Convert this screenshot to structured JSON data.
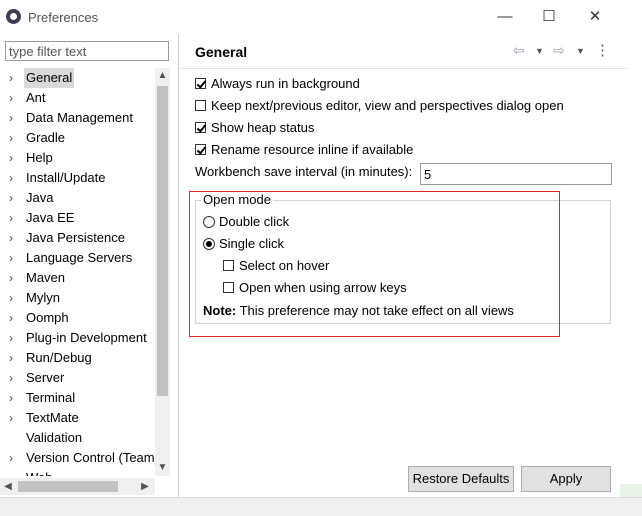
{
  "window": {
    "title": "Preferences",
    "app_icon": "eclipse-icon",
    "controls": {
      "minimize": "—",
      "maximize": "☐",
      "close": "✕"
    }
  },
  "sidebar": {
    "filter_placeholder": "type filter text",
    "selected": "General",
    "items": [
      {
        "label": "General",
        "arrow": "›"
      },
      {
        "label": "Ant",
        "arrow": "›"
      },
      {
        "label": "Data Management",
        "arrow": "›"
      },
      {
        "label": "Gradle",
        "arrow": "›"
      },
      {
        "label": "Help",
        "arrow": "›"
      },
      {
        "label": "Install/Update",
        "arrow": "›"
      },
      {
        "label": "Java",
        "arrow": "›"
      },
      {
        "label": "Java EE",
        "arrow": "›"
      },
      {
        "label": "Java Persistence",
        "arrow": "›"
      },
      {
        "label": "Language Servers",
        "arrow": "›"
      },
      {
        "label": "Maven",
        "arrow": "›"
      },
      {
        "label": "Mylyn",
        "arrow": "›"
      },
      {
        "label": "Oomph",
        "arrow": "›"
      },
      {
        "label": "Plug-in Development",
        "arrow": "›"
      },
      {
        "label": "Run/Debug",
        "arrow": "›"
      },
      {
        "label": "Server",
        "arrow": "›"
      },
      {
        "label": "Terminal",
        "arrow": "›"
      },
      {
        "label": "TextMate",
        "arrow": "›"
      },
      {
        "label": "Validation",
        "arrow": ""
      },
      {
        "label": "Version Control (Team)",
        "arrow": "›"
      },
      {
        "label": "Web",
        "arrow": "›"
      }
    ]
  },
  "page": {
    "title": "General",
    "nav_icons": [
      "back-arrow-icon",
      "dropdown-icon",
      "forward-arrow-icon",
      "dropdown-icon",
      "more-vertical-icon"
    ],
    "checkboxes": [
      {
        "label": "Always run in background",
        "checked": true
      },
      {
        "label": "Keep next/previous editor, view and perspectives dialog open",
        "checked": false
      },
      {
        "label": "Show heap status",
        "checked": true
      },
      {
        "label": "Rename resource inline if available",
        "checked": true
      }
    ],
    "save_interval_label": "Workbench save interval (in minutes):",
    "save_interval_value": "5",
    "open_mode": {
      "title": "Open mode",
      "double_click": "Double click",
      "single_click": "Single click",
      "selected": "single_click",
      "select_on_hover": "Select on hover",
      "open_arrow_keys": "Open when using arrow keys",
      "note_label": "Note:",
      "note_text": " This preference may not take effect on all views"
    },
    "buttons": {
      "restore": "Restore Defaults",
      "apply": "Apply"
    }
  },
  "colors": {
    "highlight_border": "#e0282d",
    "selected_bg": "#d9d9d9",
    "button_bg": "#e1e1e1"
  }
}
